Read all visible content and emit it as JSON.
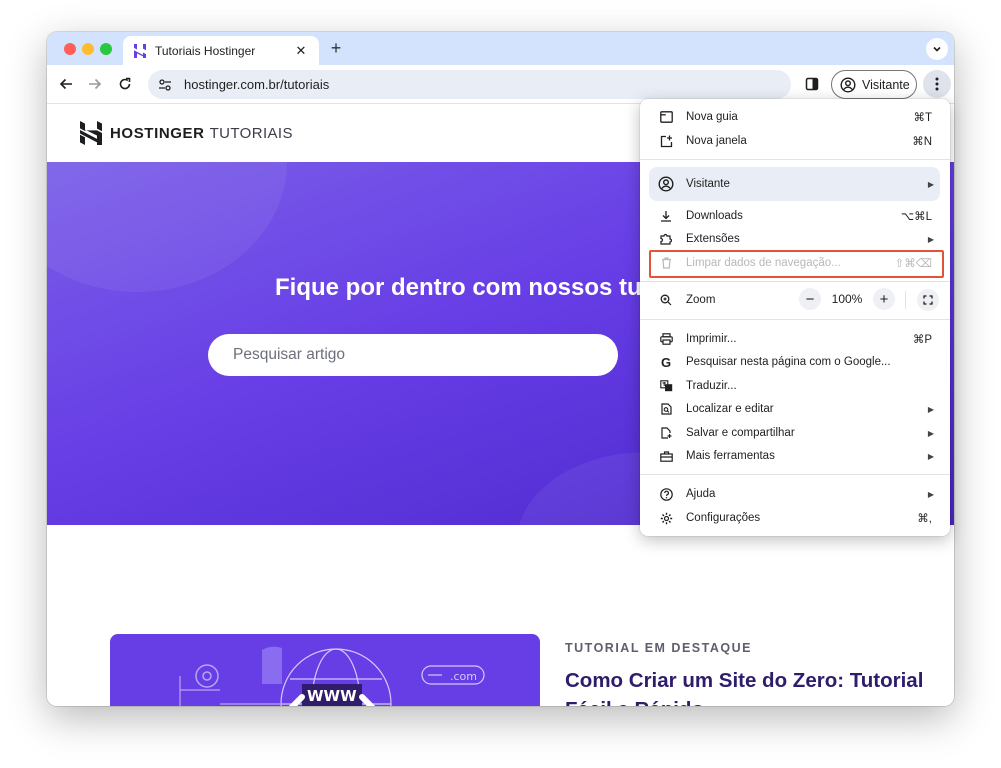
{
  "browser": {
    "tab_title": "Tutoriais Hostinger",
    "tab_close": "✕",
    "new_tab": "+",
    "url": "hostinger.com.br/tutoriais",
    "profile_label": "Visitante"
  },
  "site": {
    "logo_text": "HOSTINGER",
    "logo_sub": "TUTORIAIS",
    "hero_title": "Fique por dentro com nossos tu",
    "search_placeholder": "Pesquisar artigo",
    "featured_kicker": "TUTORIAL EM DESTAQUE",
    "featured_title": "Como Criar um Site do Zero: Tutorial Fácil e Rápido",
    "card_www": "WWW",
    "card_com": ".com"
  },
  "menu": {
    "new_tab": {
      "label": "Nova guia",
      "shortcut": "⌘T"
    },
    "new_window": {
      "label": "Nova janela",
      "shortcut": "⌘N"
    },
    "profile": {
      "label": "Visitante"
    },
    "downloads": {
      "label": "Downloads",
      "shortcut": "⌥⌘L"
    },
    "extensions": {
      "label": "Extensões"
    },
    "clear_data": {
      "label": "Limpar dados de navegação...",
      "shortcut": "⇧⌘⌫"
    },
    "zoom": {
      "label": "Zoom",
      "value": "100%",
      "minus": "−",
      "plus": "+"
    },
    "print": {
      "label": "Imprimir...",
      "shortcut": "⌘P"
    },
    "search_google": {
      "label": "Pesquisar nesta página com o Google..."
    },
    "translate": {
      "label": "Traduzir..."
    },
    "find_edit": {
      "label": "Localizar e editar"
    },
    "save_share": {
      "label": "Salvar e compartilhar"
    },
    "more_tools": {
      "label": "Mais ferramentas"
    },
    "help": {
      "label": "Ajuda"
    },
    "settings": {
      "label": "Configurações",
      "shortcut": "⌘,"
    },
    "submenu_arrow": "▶"
  },
  "colors": {
    "brand_purple": "#673de6",
    "highlight_red": "#e0553a",
    "tab_strip": "#d3e3fd"
  }
}
